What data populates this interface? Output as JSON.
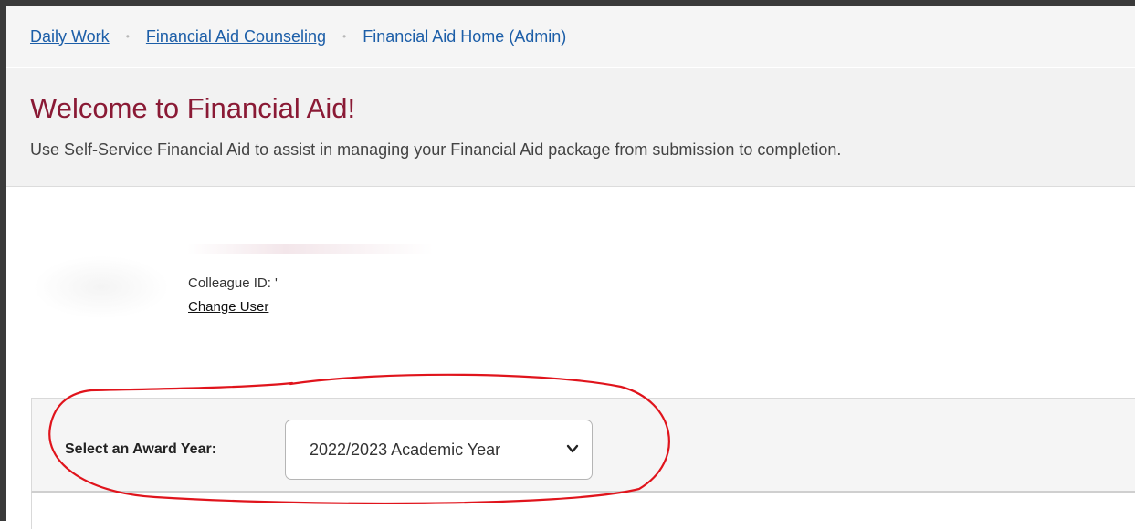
{
  "breadcrumb": {
    "items": [
      {
        "label": "Daily Work"
      },
      {
        "label": "Financial Aid Counseling"
      },
      {
        "label": "Financial Aid Home (Admin)"
      }
    ],
    "separator": "•"
  },
  "header": {
    "title": "Welcome to Financial Aid!",
    "subtitle": "Use Self-Service Financial Aid to assist in managing your Financial Aid package from submission to completion."
  },
  "user": {
    "colleague_id_label": "Colleague ID: '",
    "change_user_label": "Change User"
  },
  "award_year": {
    "label": "Select an Award Year:",
    "selected": "2022/2023 Academic Year"
  },
  "colors": {
    "title": "#8a1a35",
    "link": "#1c5ea8",
    "annotation_stroke": "#e0141c"
  },
  "icons": [
    "chevron-down-icon"
  ]
}
